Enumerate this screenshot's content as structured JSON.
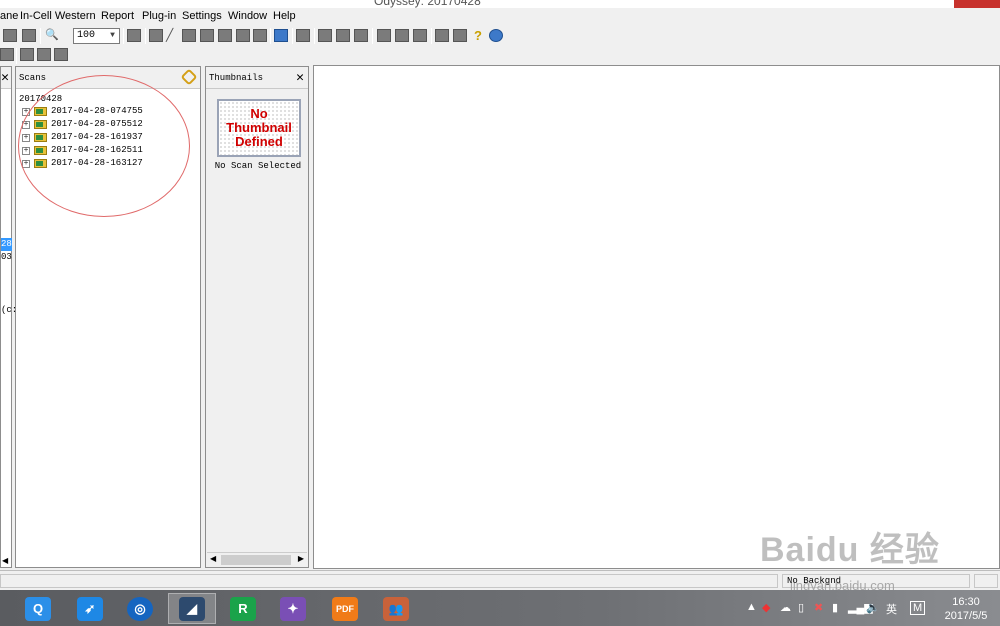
{
  "window": {
    "title": "Odyssey: 20170428"
  },
  "menu": [
    "ane",
    "In-Cell Western",
    "Report",
    "Plug-in",
    "Settings",
    "Window",
    "Help"
  ],
  "toolbar": {
    "zoom_value": "100",
    "help_glyph": "?"
  },
  "left_panel": {
    "selected_fragment": "28",
    "fragment2": "03",
    "fragment3": "(c:"
  },
  "scans": {
    "title": "Scans",
    "root": "20170428",
    "items": [
      "2017-04-28-074755",
      "2017-04-28-075512",
      "2017-04-28-161937",
      "2017-04-28-162511",
      "2017-04-28-163127"
    ]
  },
  "thumbnails": {
    "title": "Thumbnails",
    "placeholder_lines": [
      "No",
      "Thumbnail",
      "Defined"
    ],
    "caption": "No Scan Selected"
  },
  "status": {
    "background": "No Backgnd"
  },
  "taskbar": {
    "apps": [
      {
        "name": "qq-browser-icon",
        "color": "#2b8fe8",
        "glyph": "Q"
      },
      {
        "name": "swift-icon",
        "color": "#1e88e5",
        "glyph": "➶"
      },
      {
        "name": "browser-icon",
        "color": "#1565c0",
        "glyph": "◎"
      },
      {
        "name": "odyssey-icon",
        "color": "#2d4a6e",
        "glyph": "◢"
      },
      {
        "name": "r-app-icon",
        "color": "#1aa34a",
        "glyph": "R"
      },
      {
        "name": "prism-icon",
        "color": "#7a4fb5",
        "glyph": "✦"
      },
      {
        "name": "pdf-icon",
        "color": "#f07b18",
        "glyph": "PDF"
      },
      {
        "name": "people-icon",
        "color": "#c8623a",
        "glyph": "👥"
      }
    ],
    "ime": "英",
    "ime2": "M",
    "time": "16:30",
    "date": "2017/5/5"
  },
  "watermark": {
    "main": "Baidu 经验",
    "sub": "jingyan.baidu.com"
  }
}
